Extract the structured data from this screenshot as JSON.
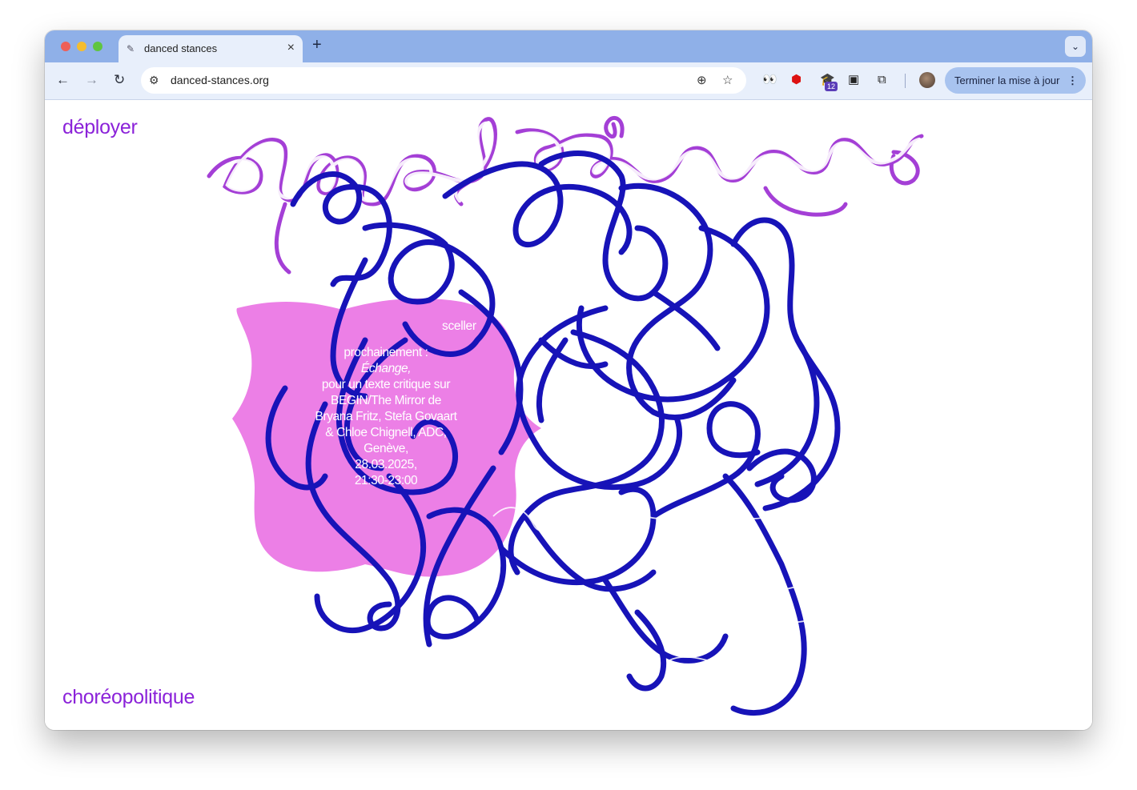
{
  "browser": {
    "tab_title": "danced stances",
    "tab_close": "×",
    "new_tab": "+",
    "tab_dropdown": "⌄",
    "url": "danced-stances.org",
    "ext_badge": "12",
    "update_label": "Terminer la mise à jour",
    "update_menu": "⋮",
    "icons": {
      "back": "←",
      "forward": "→",
      "reload": "↻",
      "site_info": "⚙",
      "zoom": "⊕",
      "star": "☆",
      "eyes": "👀",
      "shield": "⬢",
      "hat": "🎓",
      "box": "▣",
      "puzzle": "⧉"
    },
    "colors": {
      "frame": "#8fb0e8",
      "toolbar": "#e8effb"
    }
  },
  "page": {
    "nav_top": "déployer",
    "nav_bottom": "choréopolitique",
    "blob_button": "sceller",
    "announcement": {
      "line1": "prochainement :",
      "event_title": "Échange,",
      "line3": "pour un texte critique sur",
      "line4": "BEGIN/The Mirror de",
      "line5": "Bryana Fritz, Stefa Govaart",
      "line6": "& Chloe Chignell, ADC,",
      "line7": "Genève,",
      "date": "28.03.2025,",
      "time": "21:30-23:00"
    },
    "colors": {
      "link": "#8b22d9",
      "scribble": "#1713b8",
      "blob": "#ec7fe6",
      "logo_outline": "#a43fd6"
    }
  }
}
